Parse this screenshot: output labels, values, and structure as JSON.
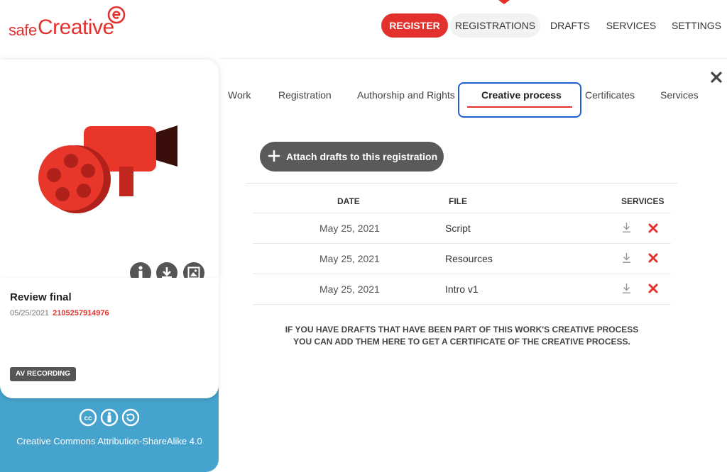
{
  "logo": {
    "safe": "safe",
    "creative": "Creative"
  },
  "nav": {
    "register": "REGISTER",
    "registrations": "REGISTRATIONS",
    "drafts": "DRAFTS",
    "services": "SERVICES",
    "settings": "SETTINGS"
  },
  "card": {
    "title": "Review final",
    "date": "05/25/2021",
    "code": "2105257914976",
    "badge": "AV RECORDING",
    "license": "Creative Commons Attribution-ShareAlike 4.0"
  },
  "tabs": [
    {
      "label": "Work"
    },
    {
      "label": "Registration"
    },
    {
      "label": "Authorship and Rights"
    },
    {
      "label": "Creative process"
    },
    {
      "label": "Certificates"
    },
    {
      "label": "Services"
    }
  ],
  "attach_label": "Attach drafts to this registration",
  "table": {
    "headers": {
      "date": "DATE",
      "file": "FILE",
      "services": "SERVICES"
    },
    "rows": [
      {
        "date": "May 25, 2021",
        "file": "Script"
      },
      {
        "date": "May 25, 2021",
        "file": "Resources"
      },
      {
        "date": "May 25, 2021",
        "file": "Intro v1"
      }
    ]
  },
  "note": {
    "line1": "IF YOU HAVE DRAFTS THAT HAVE BEEN PART OF THIS WORK'S CREATIVE PROCESS",
    "line2": "YOU CAN ADD THEM HERE TO GET A CERTIFICATE OF THE CREATIVE PROCESS."
  },
  "colors": {
    "brand_red": "#e3312d",
    "license_blue": "#45a3cd",
    "active_tab_border": "#1f5fd6",
    "dark_button": "#5a5a5a"
  },
  "icons": [
    "close-icon",
    "plus-icon",
    "info-icon",
    "download-icon",
    "image-icon",
    "delete-icon",
    "cc-icon",
    "by-icon",
    "sa-icon"
  ]
}
